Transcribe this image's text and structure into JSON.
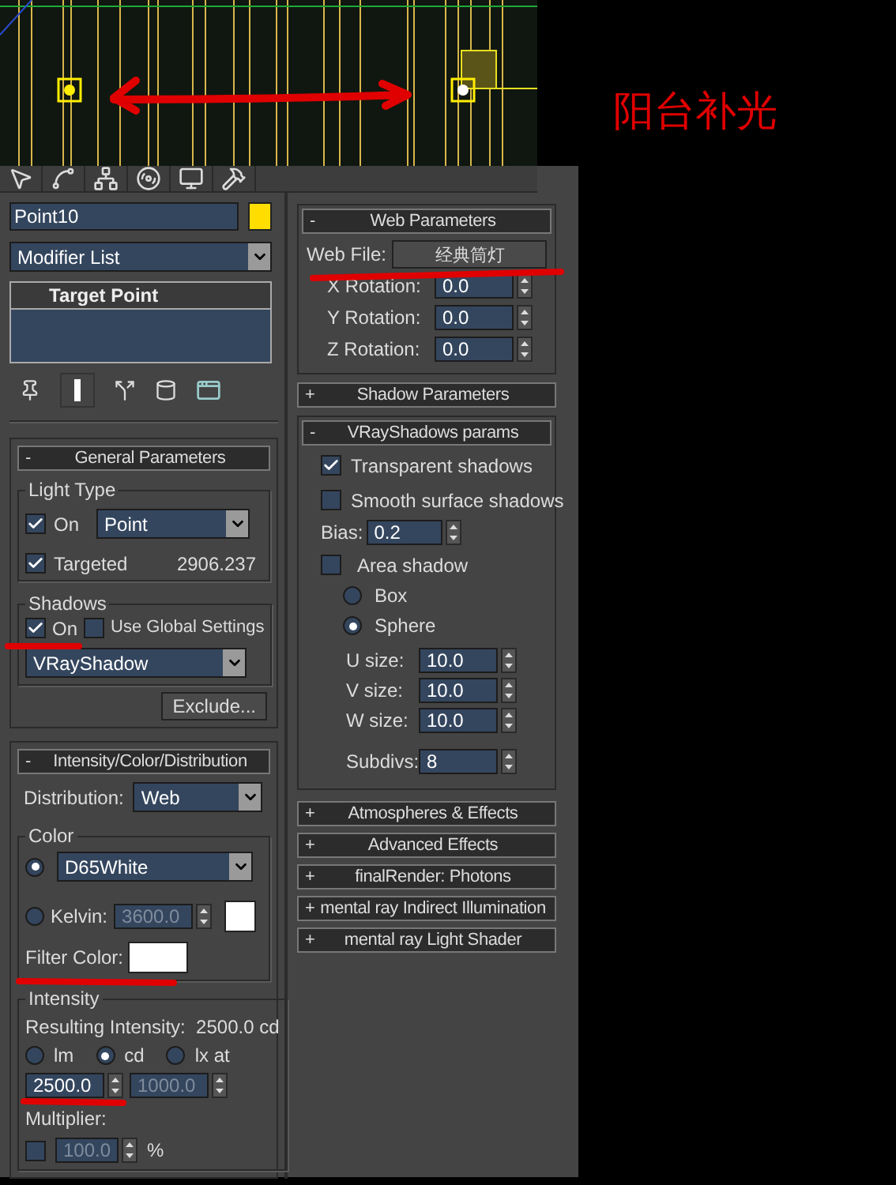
{
  "annotation": "阳台补光",
  "object": {
    "name": "Point10",
    "color": "#ffdd00"
  },
  "modifier_list": "Modifier List",
  "stack_items": [
    "Target Point"
  ],
  "general_parameters": {
    "sign": "-",
    "title": "General Parameters",
    "light_type": {
      "label": "Light Type",
      "on": {
        "label": "On",
        "checked": true
      },
      "type": "Point",
      "targeted": {
        "label": "Targeted",
        "checked": true
      },
      "target_distance": "2906.237"
    },
    "shadows": {
      "label": "Shadows",
      "on": {
        "label": "On",
        "checked": true
      },
      "use_global": {
        "label": "Use Global Settings",
        "checked": false
      },
      "type": "VRayShadow"
    },
    "exclude_button": "Exclude..."
  },
  "intensity_color_distribution": {
    "sign": "-",
    "title": "Intensity/Color/Distribution",
    "distribution_label": "Distribution:",
    "distribution": "Web",
    "color": {
      "label": "Color",
      "preset": {
        "selected": true,
        "value": "D65White"
      },
      "kelvin": {
        "selected": false,
        "label": "Kelvin:",
        "value": "3600.0",
        "disabled": true
      },
      "filter_label": "Filter Color:"
    },
    "intensity": {
      "label": "Intensity",
      "resulting": "Resulting Intensity:  2500.0 cd",
      "units": [
        {
          "label": "lm",
          "selected": false
        },
        {
          "label": "cd",
          "selected": true
        },
        {
          "label": "lx at",
          "selected": false
        }
      ],
      "value": {
        "value": "2500.0",
        "disabled": false
      },
      "distance": {
        "value": "1000.0",
        "disabled": true
      },
      "multiplier_label": "Multiplier:",
      "multiplier": {
        "checked": false,
        "value": "100.0",
        "disabled": true
      },
      "multiplier_unit": "%"
    }
  },
  "web_parameters": {
    "sign": "-",
    "title": "Web Parameters",
    "file_label": "Web File:",
    "file_button": "经典筒灯",
    "rotations": [
      {
        "label": "X Rotation:",
        "value": "0.0"
      },
      {
        "label": "Y Rotation:",
        "value": "0.0"
      },
      {
        "label": "Z Rotation:",
        "value": "0.0"
      }
    ]
  },
  "shadow_parameters": {
    "sign": "+",
    "title": "Shadow Parameters"
  },
  "vray_shadows": {
    "sign": "-",
    "title": "VRayShadows params",
    "transparent": {
      "label": "Transparent shadows",
      "checked": true
    },
    "smooth": {
      "label": "Smooth surface shadows",
      "checked": false
    },
    "bias_label": "Bias:",
    "bias": "0.2",
    "area_shadow": {
      "label": "Area shadow",
      "checked": false
    },
    "shapes": [
      {
        "label": "Box",
        "selected": false
      },
      {
        "label": "Sphere",
        "selected": true
      }
    ],
    "sizes": [
      {
        "label": "U size:",
        "value": "10.0"
      },
      {
        "label": "V size:",
        "value": "10.0"
      },
      {
        "label": "W size:",
        "value": "10.0"
      }
    ],
    "subdivs_label": "Subdivs:",
    "subdivs": "8"
  },
  "collapsed_rollouts": [
    {
      "sign": "+",
      "title": "Atmospheres & Effects"
    },
    {
      "sign": "+",
      "title": "Advanced Effects"
    },
    {
      "sign": "+",
      "title": "finalRender: Photons"
    },
    {
      "sign": "+",
      "title": "mental ray Indirect Illumination"
    },
    {
      "sign": "+",
      "title": "mental ray Light Shader"
    }
  ]
}
